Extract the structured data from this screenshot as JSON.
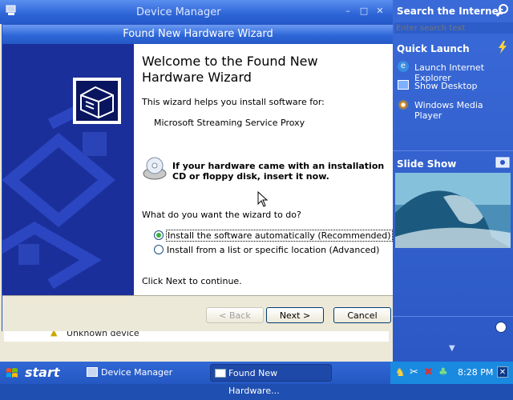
{
  "device_manager": {
    "title": "Device Manager",
    "list_item": "Unknown device"
  },
  "wizard": {
    "title": "Found New Hardware Wizard",
    "heading": "Welcome to the Found New Hardware Wizard",
    "intro": "This wizard helps you install software for:",
    "device": "Microsoft Streaming Service Proxy",
    "cd_note": "If your hardware came with an installation CD or floppy disk, insert it now.",
    "question": "What do you want the wizard to do?",
    "options": [
      {
        "label": "Install the software automatically (Recommended)",
        "selected": true
      },
      {
        "label": "Install from a list or specific location (Advanced)",
        "selected": false
      }
    ],
    "continue_text": "Click Next to continue.",
    "back_label": "< Back",
    "next_label": "Next >",
    "cancel_label": "Cancel"
  },
  "sidebar": {
    "search_title": "Search the Internet",
    "search_placeholder": "Enter search text",
    "quick_launch_title": "Quick Launch",
    "quick_launch_items": [
      {
        "label": "Launch Internet Explorer",
        "icon": "internet-explorer-icon"
      },
      {
        "label": "Show Desktop",
        "icon": "desktop-icon"
      },
      {
        "label": "Windows Media Player",
        "icon": "media-player-icon"
      }
    ],
    "slide_show_title": "Slide Show"
  },
  "taskbar": {
    "start_label": "start",
    "tasks": [
      {
        "label": "Device Manager"
      },
      {
        "label": "Found New Hardware..."
      }
    ],
    "clock": "8:28 PM"
  },
  "colors": {
    "title_blue": "#2d64d6",
    "panel_blue": "#2b58c4",
    "tray_blue": "#1a8ae0",
    "radio_green": "#3cb13c"
  }
}
